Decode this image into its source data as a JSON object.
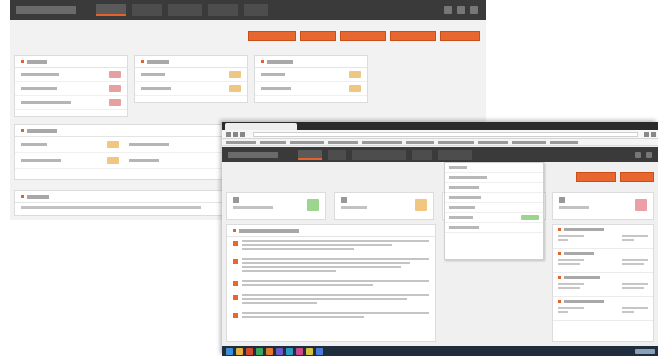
{
  "back_window": {
    "nav": {
      "app_title": "",
      "tabs": [
        {
          "label": "",
          "active": true
        },
        {
          "label": "",
          "active": false
        },
        {
          "label": "",
          "active": false
        },
        {
          "label": "",
          "active": false
        },
        {
          "label": "",
          "active": false
        }
      ],
      "icons": [
        "settings-icon",
        "user-icon",
        "menu-icon"
      ]
    },
    "action_buttons": [
      "",
      "",
      "",
      "",
      ""
    ],
    "cards": [
      {
        "title": "",
        "rows": [
          {
            "label": "",
            "badge": "red"
          },
          {
            "label": "",
            "badge": "red"
          },
          {
            "label": "",
            "badge": "red"
          }
        ]
      },
      {
        "title": "",
        "rows": [
          {
            "label": "",
            "badge": "orange"
          },
          {
            "label": "",
            "badge": "orange"
          }
        ]
      },
      {
        "title": "",
        "rows": [
          {
            "label": "",
            "badge": "orange"
          },
          {
            "label": "",
            "badge": "orange"
          }
        ]
      }
    ],
    "wide_card": {
      "title": "",
      "rows": [
        {
          "left_label": "",
          "left_badge": "orange",
          "right_label": ""
        },
        {
          "left_label": "",
          "left_badge": "orange",
          "right_label": ""
        }
      ]
    },
    "footer_card": {
      "title": "",
      "body": ""
    }
  },
  "front_window": {
    "browser": {
      "tab_title": "",
      "address": "",
      "bookmarks": [
        "",
        "",
        "",
        "",
        "",
        "",
        "",
        "",
        "",
        ""
      ]
    },
    "nav": {
      "app_title": "",
      "tabs": [
        {
          "label": "",
          "active": true
        },
        {
          "label": "",
          "active": false
        },
        {
          "label": "",
          "active": false
        },
        {
          "label": "",
          "active": false
        },
        {
          "label": "",
          "active": false
        }
      ]
    },
    "action_buttons": [
      "",
      ""
    ],
    "widgets": [
      {
        "value": "",
        "label": "",
        "color": "#9cd58e"
      },
      {
        "value": "",
        "label": "",
        "color": "#f0c680"
      },
      {
        "value": "",
        "label": "",
        "color": "#c8c8c8"
      },
      {
        "value": "",
        "label": "",
        "color": "#eaa0a6"
      }
    ],
    "dropdown_items": [
      {
        "label": "",
        "badge": ""
      },
      {
        "label": "",
        "badge": ""
      },
      {
        "label": "",
        "badge": ""
      },
      {
        "label": "",
        "badge": ""
      },
      {
        "label": "",
        "badge": ""
      },
      {
        "label": "",
        "badge": "green"
      },
      {
        "label": "",
        "badge": ""
      }
    ],
    "task_list": {
      "title": "",
      "items": [
        "",
        "",
        "",
        "",
        ""
      ]
    },
    "right_panel": [
      {
        "title": "",
        "left": "",
        "right": ""
      },
      {
        "title": "",
        "left": "",
        "right": ""
      },
      {
        "title": "",
        "left": "",
        "right": ""
      },
      {
        "title": "",
        "left": "",
        "right": ""
      }
    ]
  },
  "colors": {
    "accent": "#e8672e",
    "nav_bg": "#3a3a3a",
    "taskbar_bg": "#1f2d3d"
  }
}
